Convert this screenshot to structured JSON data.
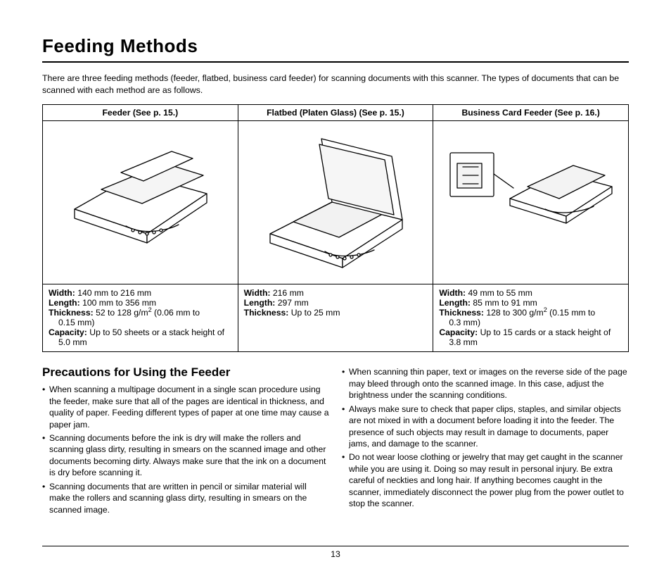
{
  "page": {
    "title": "Feeding Methods",
    "intro": "There are three feeding methods (feeder, flatbed, business card feeder) for scanning documents with this scanner. The types of documents that can be scanned with each method are as follows.",
    "page_number": "13"
  },
  "table": {
    "headers": [
      "Feeder (See p. 15.)",
      "Flatbed (Platen Glass) (See p. 15.)",
      "Business Card Feeder (See p. 16.)"
    ],
    "specs": [
      {
        "width_label": "Width:",
        "width": "140 mm to 216 mm",
        "length_label": "Length:",
        "length": "100 mm to 356 mm",
        "thickness_label": "Thickness:",
        "thickness_a": "52 to 128 g/m",
        "thickness_b": " (0.06 mm to",
        "thickness_c": "0.15 mm)",
        "capacity_label": "Capacity:",
        "capacity_a": "Up to 50 sheets or a stack height of",
        "capacity_b": "5.0 mm"
      },
      {
        "width_label": "Width:",
        "width": "216 mm",
        "length_label": "Length:",
        "length": "297 mm",
        "thickness_label": "Thickness:",
        "thickness_a": "Up to 25 mm"
      },
      {
        "width_label": "Width:",
        "width": "49 mm to 55 mm",
        "length_label": "Length:",
        "length": "85 mm to 91 mm",
        "thickness_label": "Thickness:",
        "thickness_a": "128 to 300 g/m",
        "thickness_b": " (0.15 mm to",
        "thickness_c": "0.3 mm)",
        "capacity_label": "Capacity:",
        "capacity_a": "Up to 15 cards or a stack height of",
        "capacity_b": "3.8 mm"
      }
    ]
  },
  "precautions": {
    "heading": "Precautions for Using the Feeder",
    "left": [
      "When scanning a multipage document in a single scan procedure using the feeder, make sure that all of the pages are identical in thickness, and quality of paper. Feeding different types of paper at one time may cause a paper jam.",
      "Scanning documents before the ink is dry will make the rollers and scanning glass dirty, resulting in smears on the scanned image and other documents becoming dirty. Always make sure that the ink on a document is dry before scanning it.",
      "Scanning documents that are written in pencil or similar material will make the rollers and scanning glass dirty, resulting in smears on the scanned image."
    ],
    "right": [
      "When scanning thin paper, text or images on the reverse side of the page may bleed through onto the scanned image. In this case, adjust the brightness under the scanning conditions.",
      "Always make sure to check that paper clips, staples, and similar objects are not mixed in with a document before loading it into the feeder. The presence of such objects may result in damage to documents, paper jams, and damage to the scanner.",
      "Do not wear loose clothing or jewelry that may get caught in the scanner while you are using it. Doing so may result in personal injury. Be extra careful of neckties and long hair. If anything becomes caught in the scanner, immediately disconnect the power plug from the power outlet to stop the scanner."
    ]
  }
}
